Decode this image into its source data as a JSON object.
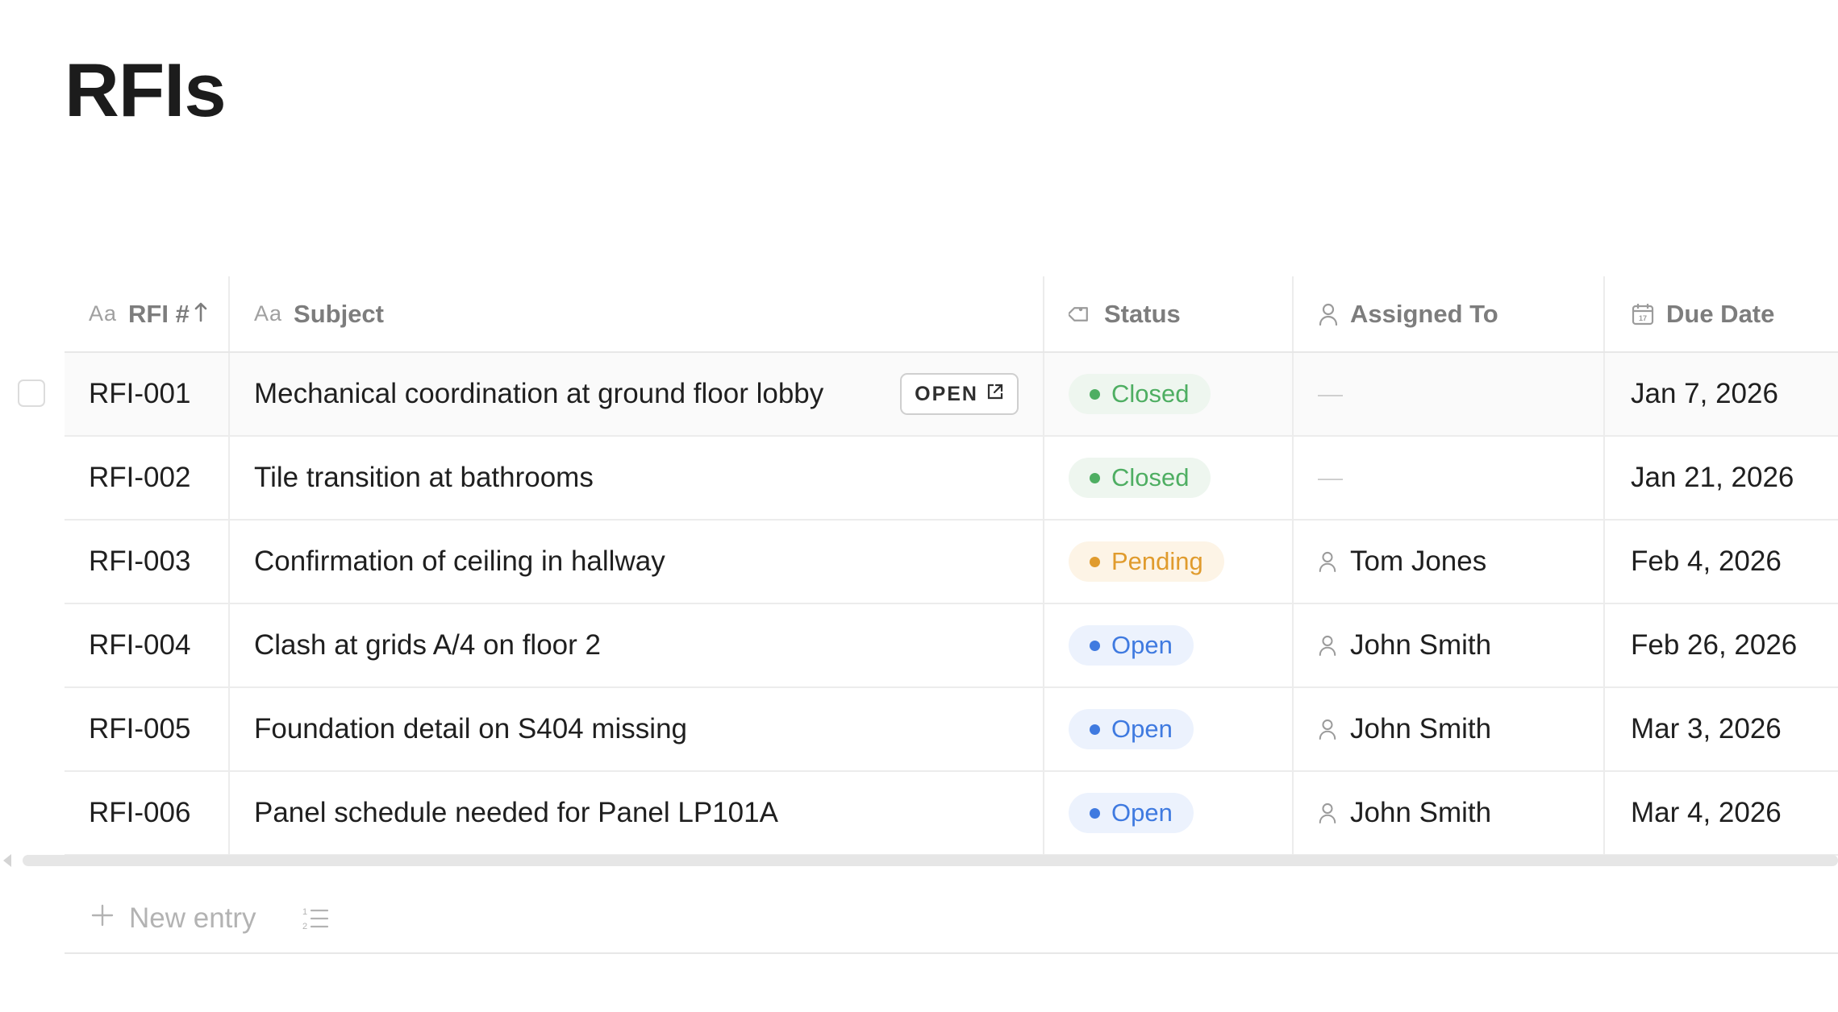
{
  "page": {
    "title": "RFIs"
  },
  "columns": {
    "rfi": {
      "label": "RFI #",
      "icon": "text-aa-icon",
      "sort": "ascending"
    },
    "subject": {
      "label": "Subject",
      "icon": "text-aa-icon"
    },
    "status": {
      "label": "Status",
      "icon": "tag-icon"
    },
    "assigned": {
      "label": "Assigned To",
      "icon": "person-icon"
    },
    "due": {
      "label": "Due Date",
      "icon": "calendar-icon"
    },
    "type_glyph": "Aa"
  },
  "open_button": {
    "label": "OPEN"
  },
  "empty_value": "—",
  "rows": [
    {
      "rfi": "RFI-001",
      "subject": "Mechanical coordination at ground floor lobby",
      "status": "Closed",
      "assigned": "",
      "due": "Jan 7, 2026"
    },
    {
      "rfi": "RFI-002",
      "subject": "Tile transition at bathrooms",
      "status": "Closed",
      "assigned": "",
      "due": "Jan 21, 2026"
    },
    {
      "rfi": "RFI-003",
      "subject": "Confirmation of ceiling in hallway",
      "status": "Pending",
      "assigned": "Tom Jones",
      "due": "Feb 4, 2026"
    },
    {
      "rfi": "RFI-004",
      "subject": "Clash at grids A/4 on floor 2",
      "status": "Open",
      "assigned": "John Smith",
      "due": "Feb 26, 2026"
    },
    {
      "rfi": "RFI-005",
      "subject": "Foundation detail on S404 missing",
      "status": "Open",
      "assigned": "John Smith",
      "due": "Mar 3, 2026"
    },
    {
      "rfi": "RFI-006",
      "subject": "Panel schedule needed for Panel LP101A",
      "status": "Open",
      "assigned": "John Smith",
      "due": "Mar 4, 2026"
    }
  ],
  "status_colors": {
    "Closed": "#4eae62",
    "Pending": "#e09b2d",
    "Open": "#3f7ae0"
  },
  "footer": {
    "new_entry_label": "New entry"
  }
}
